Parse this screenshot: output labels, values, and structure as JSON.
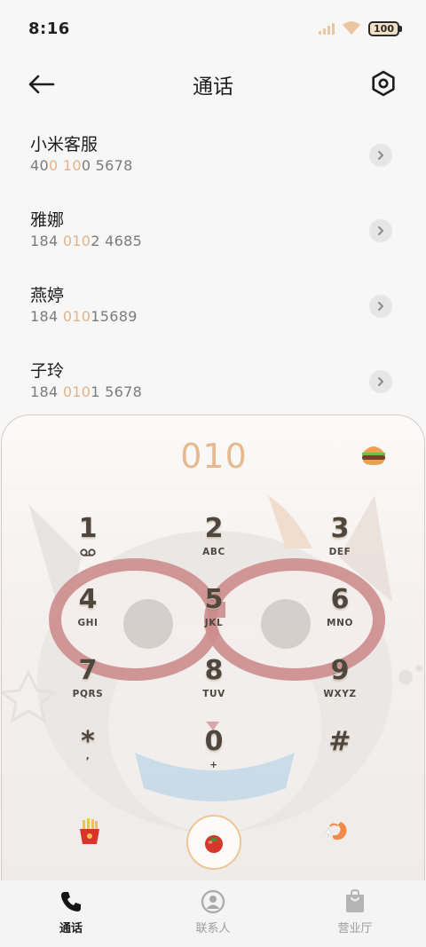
{
  "status_bar": {
    "time": "8:16",
    "battery": "100"
  },
  "header": {
    "title": "通话"
  },
  "contacts": [
    {
      "name": "小米客服",
      "number_parts": [
        "40",
        "0",
        " ",
        "10",
        "0 5678"
      ]
    },
    {
      "name": "雅娜",
      "number_parts": [
        "184 ",
        "010",
        "2 4685"
      ]
    },
    {
      "name": "燕婷",
      "number_parts": [
        "184 ",
        "010",
        "15689"
      ]
    },
    {
      "name": "子玲",
      "number_parts": [
        "184 ",
        "010",
        "1 5678"
      ]
    }
  ],
  "dialer": {
    "input": "010",
    "keys": [
      {
        "digit": "1",
        "letters": ""
      },
      {
        "digit": "2",
        "letters": "ABC"
      },
      {
        "digit": "3",
        "letters": "DEF"
      },
      {
        "digit": "4",
        "letters": "GHI"
      },
      {
        "digit": "5",
        "letters": "JKL"
      },
      {
        "digit": "6",
        "letters": "MNO"
      },
      {
        "digit": "7",
        "letters": "PQRS"
      },
      {
        "digit": "8",
        "letters": "TUV"
      },
      {
        "digit": "9",
        "letters": "WXYZ"
      },
      {
        "digit": "*",
        "letters": ","
      },
      {
        "digit": "0",
        "letters": "+"
      },
      {
        "digit": "#",
        "letters": ""
      }
    ]
  },
  "tabs": [
    {
      "label": "通话",
      "icon": "phone-icon",
      "active": true
    },
    {
      "label": "联系人",
      "icon": "contacts-icon",
      "active": false
    },
    {
      "label": "营业厅",
      "icon": "shopping-bag-icon",
      "active": false
    }
  ],
  "colors": {
    "accent": "#e6b286",
    "call_ring": "#efc591",
    "key_text": "#4f463d"
  }
}
